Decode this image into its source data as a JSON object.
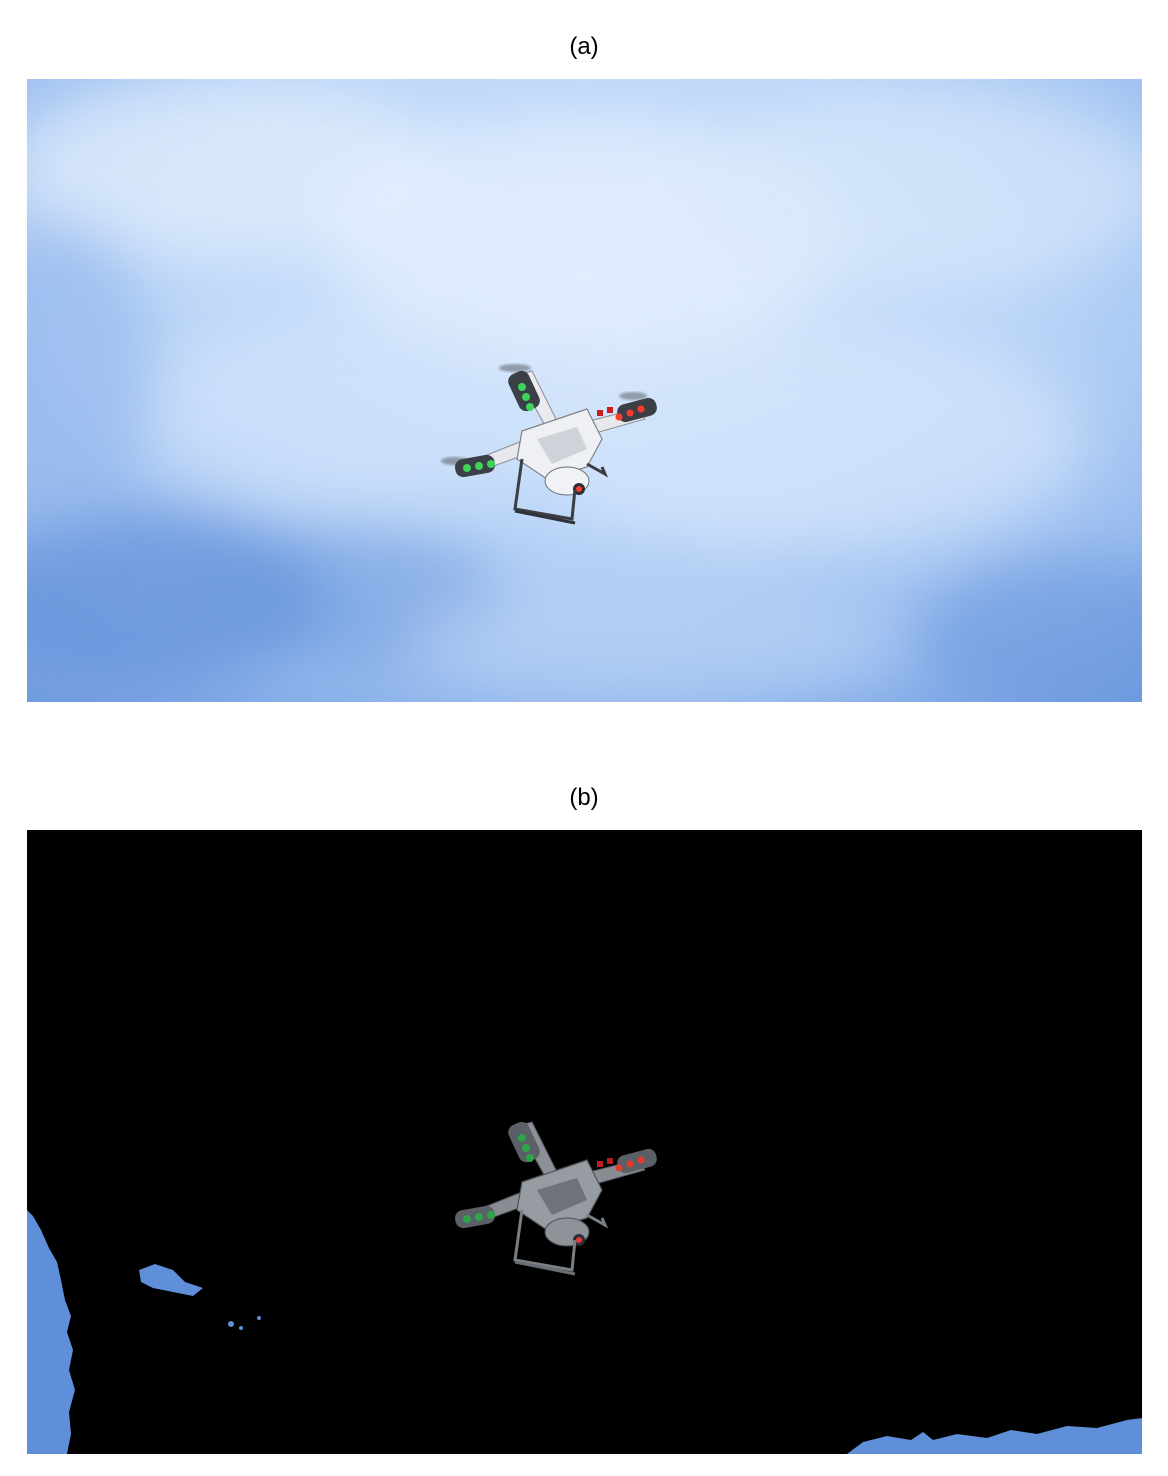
{
  "panels": [
    {
      "caption": "(a)"
    },
    {
      "caption": "(b)"
    }
  ],
  "colors": {
    "sky_light": "#cfe2fa",
    "sky_mid": "#a9c7f2",
    "sky_dark": "#5e8fd8",
    "drone_body": "#e8eaee",
    "drone_dark": "#3a3d44",
    "led_green": "#3ed45a",
    "led_red": "#ff3b30",
    "background_mask": "#000000"
  }
}
